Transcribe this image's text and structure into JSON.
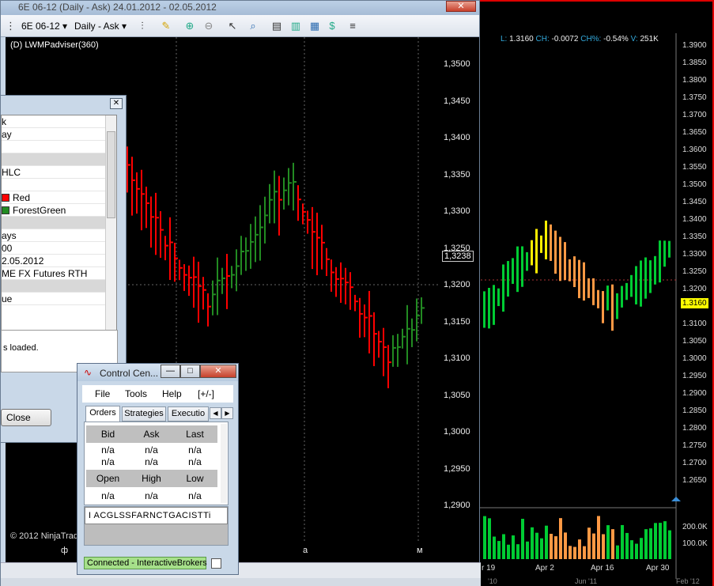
{
  "right_chart": {
    "header": {
      "l_label": "L:",
      "l_value": "1.3160",
      "ch_label": "CH:",
      "ch_value": "-0.0072",
      "chp_label": "CH%:",
      "chp_value": "-0.54%",
      "v_label": "V:",
      "v_value": "251K"
    },
    "price_axis": [
      "1.3900",
      "1.3850",
      "1.3800",
      "1.3750",
      "1.3700",
      "1.3650",
      "1.3600",
      "1.3550",
      "1.3500",
      "1.3450",
      "1.3400",
      "1.3350",
      "1.3300",
      "1.3250",
      "1.3200",
      "1.3100",
      "1.3050",
      "1.3000",
      "1.2950",
      "1.2900",
      "1.2850",
      "1.2800",
      "1.2750",
      "1.2700",
      "1.2650"
    ],
    "last_price": "1.3160",
    "volume_axis": [
      "200.0K",
      "100.0K"
    ],
    "date_labels": [
      "r 19",
      "Apr 2",
      "Apr 16",
      "Apr 30"
    ],
    "bottom_labels": [
      "'10",
      "Jun '11",
      "Feb '12"
    ],
    "colors": {
      "up": "#00cc33",
      "down": "#ff9944",
      "highlight": "#ffee00"
    }
  },
  "chart_window": {
    "title": "6E 06-12 (Daily - Ask)  24.01.2012 - 02.05.2012",
    "instrument": "6E 06-12",
    "interval": "Daily - Ask",
    "indicator_label": "(D) LWMPadviser(360)",
    "copyright": "© 2012 NinjaTrad",
    "price_axis": [
      "1,3500",
      "1,3450",
      "1,3400",
      "1,3350",
      "1,3300",
      "1,3250",
      "1,3200",
      "1,3150",
      "1,3100",
      "1,3050",
      "1,3000",
      "1,2950",
      "1,2900"
    ],
    "last_price": "1,3238",
    "x_labels": [
      "ф",
      "а",
      "м"
    ],
    "colors": {
      "up": "#228b22",
      "down": "#ff0000"
    }
  },
  "properties_dialog": {
    "rows": [
      {
        "text": "k",
        "category": false
      },
      {
        "text": "ay",
        "category": false
      },
      {
        "text": "",
        "category": false
      },
      {
        "text": "",
        "category": true
      },
      {
        "text": "HLC",
        "category": false
      },
      {
        "text": "",
        "category": false
      },
      {
        "text": "Red",
        "category": false,
        "swatch": "#ff0000"
      },
      {
        "text": "ForestGreen",
        "category": false,
        "swatch": "#228b22"
      },
      {
        "text": "",
        "category": true
      },
      {
        "text": "ays",
        "category": false
      },
      {
        "text": "00",
        "category": false
      },
      {
        "text": "2.05.2012",
        "category": false
      },
      {
        "text": "ME FX Futures RTH",
        "category": false
      },
      {
        "text": "",
        "category": true
      },
      {
        "text": "ue",
        "category": false
      }
    ],
    "description": "s loaded.",
    "close_button": "Close"
  },
  "control_center": {
    "title": "Control Cen...",
    "menu": [
      "File",
      "Tools",
      "Help",
      "[+/-]"
    ],
    "tabs": [
      "Orders",
      "Strategies",
      "Executio"
    ],
    "market_headers": [
      "Bid",
      "Ask",
      "Last"
    ],
    "market_rows": [
      [
        "n/a",
        "n/a",
        "n/a"
      ],
      [
        "n/a",
        "n/a",
        "n/a"
      ]
    ],
    "range_headers": [
      "Open",
      "High",
      "Low"
    ],
    "range_values": [
      "n/a",
      "n/a",
      "n/a"
    ],
    "instruments_text": "I ACGLSSFARNCTGACISTTi",
    "status": "Connected - InteractiveBrokers"
  }
}
